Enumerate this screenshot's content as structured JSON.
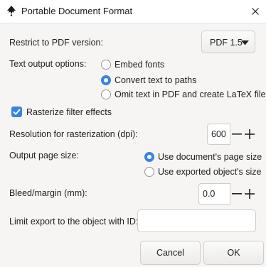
{
  "window": {
    "title": "Portable Document Format"
  },
  "pdf_version": {
    "label": "Restrict to PDF version:",
    "selected": "PDF 1.5"
  },
  "text_output": {
    "label": "Text output options:",
    "options": [
      {
        "label": "Embed fonts",
        "selected": false
      },
      {
        "label": "Convert text to paths",
        "selected": true
      },
      {
        "label": "Omit text in PDF and create LaTeX file",
        "selected": false
      }
    ]
  },
  "rasterize": {
    "label": "Rasterize filter effects",
    "checked": true
  },
  "resolution": {
    "label": "Resolution for rasterization (dpi):",
    "value": "600"
  },
  "page_size": {
    "label": "Output page size:",
    "options": [
      {
        "label": "Use document's page size",
        "selected": true
      },
      {
        "label": "Use exported object's size",
        "selected": false
      }
    ]
  },
  "bleed": {
    "label": "Bleed/margin (mm):",
    "value": "0.0"
  },
  "limit_export": {
    "label": "Limit export to the object with ID:",
    "value": ""
  },
  "buttons": {
    "cancel": "Cancel",
    "ok": "OK"
  },
  "colors": {
    "accent": "#3584e4",
    "background": "#f6f5f4"
  },
  "icons": {
    "app": "inkscape-logo-icon",
    "close": "close-icon",
    "dropdown": "triangle-down-icon",
    "minus": "minus-icon",
    "plus": "plus-icon",
    "check": "checkmark-icon"
  }
}
